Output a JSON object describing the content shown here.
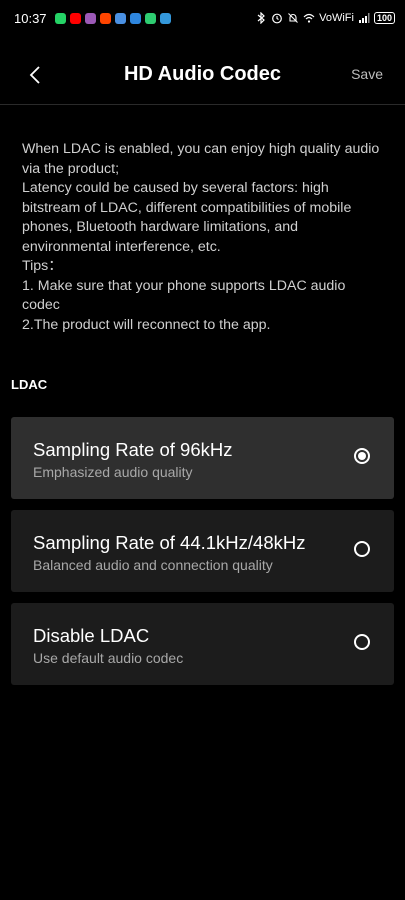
{
  "status_bar": {
    "time": "10:37",
    "app_icons": [
      {
        "name": "whatsapp-icon",
        "color": "#25D366"
      },
      {
        "name": "youtube-icon",
        "color": "#FF0000"
      },
      {
        "name": "podcast-icon",
        "color": "#9B59B6"
      },
      {
        "name": "reddit-icon",
        "color": "#FF4500"
      },
      {
        "name": "app-icon",
        "color": "#4A90E2"
      },
      {
        "name": "mail-icon",
        "color": "#2E86DE"
      },
      {
        "name": "wechat-icon",
        "color": "#2ECC71"
      },
      {
        "name": "store-icon",
        "color": "#3498DB"
      }
    ],
    "network": "VoWiFi",
    "battery": "100"
  },
  "header": {
    "title": "HD Audio Codec",
    "save_label": "Save"
  },
  "description": {
    "lines": [
      "When LDAC is enabled, you can enjoy high quality audio via the product;",
      "Latency could be caused by several factors: high bitstream of LDAC, different compatibilities of mobile phones, Bluetooth hardware limitations, and environmental interference, etc.",
      "Tips：",
      "1. Make sure that your phone supports LDAC audio codec",
      "2.The product will reconnect to the app."
    ]
  },
  "section": {
    "label": "LDAC"
  },
  "options": [
    {
      "title": "Sampling Rate of 96kHz",
      "subtitle": "Emphasized audio quality",
      "selected": true
    },
    {
      "title": "Sampling Rate of 44.1kHz/48kHz",
      "subtitle": "Balanced audio and connection quality",
      "selected": false
    },
    {
      "title": "Disable LDAC",
      "subtitle": "Use default audio codec",
      "selected": false
    }
  ]
}
